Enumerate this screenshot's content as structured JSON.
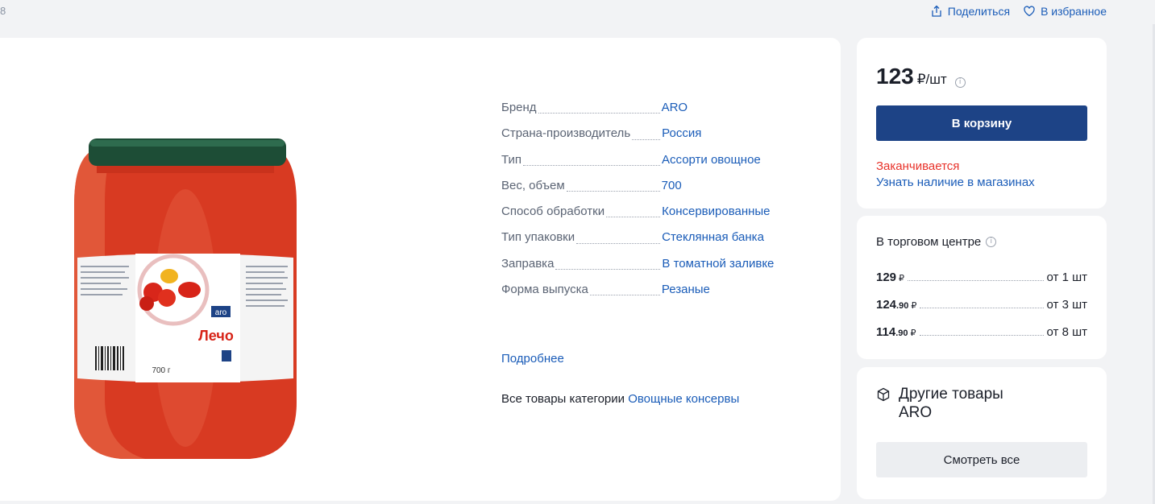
{
  "topbar": {
    "crumb_edge": "8",
    "share_label": "Поделиться",
    "favorite_label": "В избранное"
  },
  "product": {
    "image_label": "Лечо",
    "image_brand": "aro",
    "image_weight": "700 г"
  },
  "props": [
    {
      "key": "Бренд",
      "value": "ARO"
    },
    {
      "key": "Страна-производитель",
      "value": "Россия"
    },
    {
      "key": "Тип",
      "value": "Ассорти овощное"
    },
    {
      "key": "Вес, объем",
      "value": "700"
    },
    {
      "key": "Способ обработки",
      "value": "Консервированные"
    },
    {
      "key": "Тип упаковки",
      "value": "Стеклянная банка"
    },
    {
      "key": "Заправка",
      "value": "В томатной заливке"
    },
    {
      "key": "Форма выпуска",
      "value": "Резаные"
    }
  ],
  "more_label": "Подробнее",
  "category": {
    "prefix": "Все товары категории",
    "link": "Овощные консервы"
  },
  "price_card": {
    "price": "123",
    "unit": "₽/шт",
    "cart_button": "В корзину",
    "stock_status": "Заканчивается",
    "stock_link": "Узнать наличие в магазинах"
  },
  "tiers": {
    "title": "В торговом центре",
    "rows": [
      {
        "rub": "129",
        "kop": "",
        "cur": "₽",
        "qty": "от 1 шт"
      },
      {
        "rub": "124",
        "kop": ".90",
        "cur": "₽",
        "qty": "от 3 шт"
      },
      {
        "rub": "114",
        "kop": ".90",
        "cur": "₽",
        "qty": "от 8 шт"
      }
    ]
  },
  "brand_card": {
    "title_line1": "Другие товары",
    "title_line2": "ARO",
    "see_all": "Смотреть все"
  },
  "colors": {
    "accent": "#1d4386",
    "link": "#1a5cb8",
    "warning": "#e8332b"
  }
}
